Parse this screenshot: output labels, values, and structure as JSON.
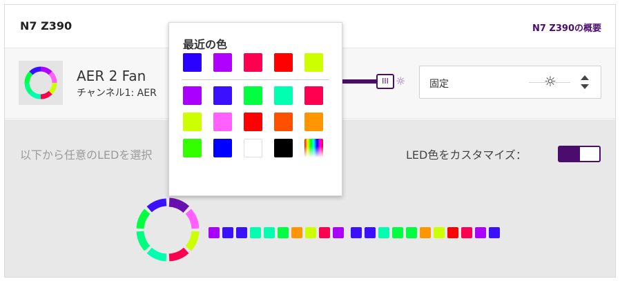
{
  "header": {
    "title": "N7 Z390",
    "overview_link": "N7 Z390の概要"
  },
  "device": {
    "name": "AER 2 Fan",
    "channel": "チャンネル1: AER",
    "slider_thumb_icon": "III",
    "brightness_icon": "sun-icon"
  },
  "mode_select": {
    "value": "固定",
    "icon": "sun-icon"
  },
  "lower": {
    "hint": "以下から任意のLEDを選択",
    "customize_label": "LED色をカスタマイズ：",
    "customize_enabled": true
  },
  "color_picker": {
    "title": "最近の色",
    "recent": [
      "#2a00ff",
      "#b000ff",
      "#ff0050",
      "#ff0000",
      "#ccff00"
    ],
    "palette": [
      [
        "#aa00ff",
        "#3a10ff",
        "#00ff40",
        "#00ffb0",
        "#ff0050"
      ],
      [
        "#ccff00",
        "#ff60ff",
        "#ff0000",
        "#ff5000",
        "#ff9500"
      ],
      [
        "#33ff00",
        "#0000ff",
        "#ffffff",
        "#000000",
        "rainbow"
      ]
    ]
  },
  "fan_segments": [
    "#6a10b0",
    "#ff60ff",
    "#ccff00",
    "#ff0050",
    "#00ffb0",
    "#00ff80",
    "#00ff40",
    "#3a10ff"
  ],
  "led_colors": [
    "#aa00ff",
    "#3a10ff",
    "#3a10ff",
    "#00ffb0",
    "#00ffb0",
    "#00ff40",
    "#ff9500",
    "#ccff00",
    "#ff0050",
    "#aa00ff",
    "#3a10ff",
    "#3a10ff",
    "#00ffb0",
    "#00ff40",
    "#00ff40",
    "#ff9500",
    "#ccff00",
    "#ff0000",
    "#ff0050",
    "#aa00ff",
    "#3a10ff"
  ],
  "colors": {
    "accent": "#4a0d6e"
  }
}
